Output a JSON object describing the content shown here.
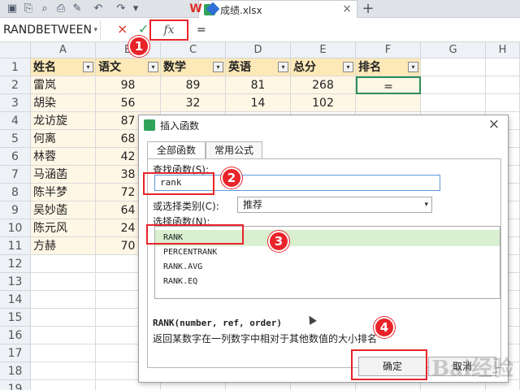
{
  "app": {
    "doc_tab_title": "成绩.xlsx",
    "tab_close": "×",
    "add_tab": "+"
  },
  "formula_bar": {
    "namebox": "RANDBETWEEN",
    "namebox_arrow": "▾",
    "cancel": "×",
    "confirm": "✓",
    "fx": "fx",
    "content": "="
  },
  "grid": {
    "columns": [
      "A",
      "B",
      "C",
      "D",
      "E",
      "F",
      "G",
      "H"
    ],
    "row_numbers": [
      "1",
      "2",
      "3",
      "4",
      "5",
      "6",
      "7",
      "8",
      "9",
      "10",
      "11",
      "12",
      "13",
      "14",
      "15",
      "16",
      "17",
      "18",
      "19"
    ],
    "headers": [
      "姓名",
      "语文",
      "数学",
      "英语",
      "总分",
      "排名"
    ],
    "rows": [
      {
        "name": "雷岚",
        "chinese": "98",
        "math": "89",
        "english": "81",
        "total": "268",
        "rank": "="
      },
      {
        "name": "胡染",
        "chinese": "56",
        "math": "32",
        "english": "14",
        "total": "102",
        "rank": ""
      },
      {
        "name": "龙访旋",
        "chinese": "87"
      },
      {
        "name": "何离",
        "chinese": "68"
      },
      {
        "name": "林蓉",
        "chinese": "42"
      },
      {
        "name": "马涵菡",
        "chinese": "38"
      },
      {
        "name": "陈半梦",
        "chinese": "72"
      },
      {
        "name": "吴妙菡",
        "chinese": "64"
      },
      {
        "name": "陈元风",
        "chinese": "24"
      },
      {
        "name": "方赫",
        "chinese": "70"
      }
    ],
    "filter_glyph": "▾"
  },
  "dialog": {
    "title": "插入函数",
    "close": "×",
    "tabs": [
      "全部函数",
      "常用公式"
    ],
    "search_label": "查找函数(S):",
    "search_value": "rank",
    "category_label": "或选择类别(C):",
    "category_value": "推荐",
    "category_arrow": "▾",
    "function_list_label": "选择函数(N):",
    "functions": [
      "RANK",
      "PERCENTRANK",
      "RANK.AVG",
      "RANK.EQ"
    ],
    "selected_index": 0,
    "syntax": "RANK(number, ref, order)",
    "description": "返回某数字在一列数字中相对于其他数值的大小排名",
    "ok_label": "确定",
    "cancel_label": "取消"
  },
  "markers": [
    "1",
    "2",
    "3",
    "4"
  ],
  "watermark": "Bai经验",
  "colors": {
    "header_fill": "#fde9b8",
    "data_fill": "#fff7e6",
    "marker_red": "#e8242a",
    "selected_fn": "#d9efd0",
    "active_cell": "#2e8b57"
  }
}
